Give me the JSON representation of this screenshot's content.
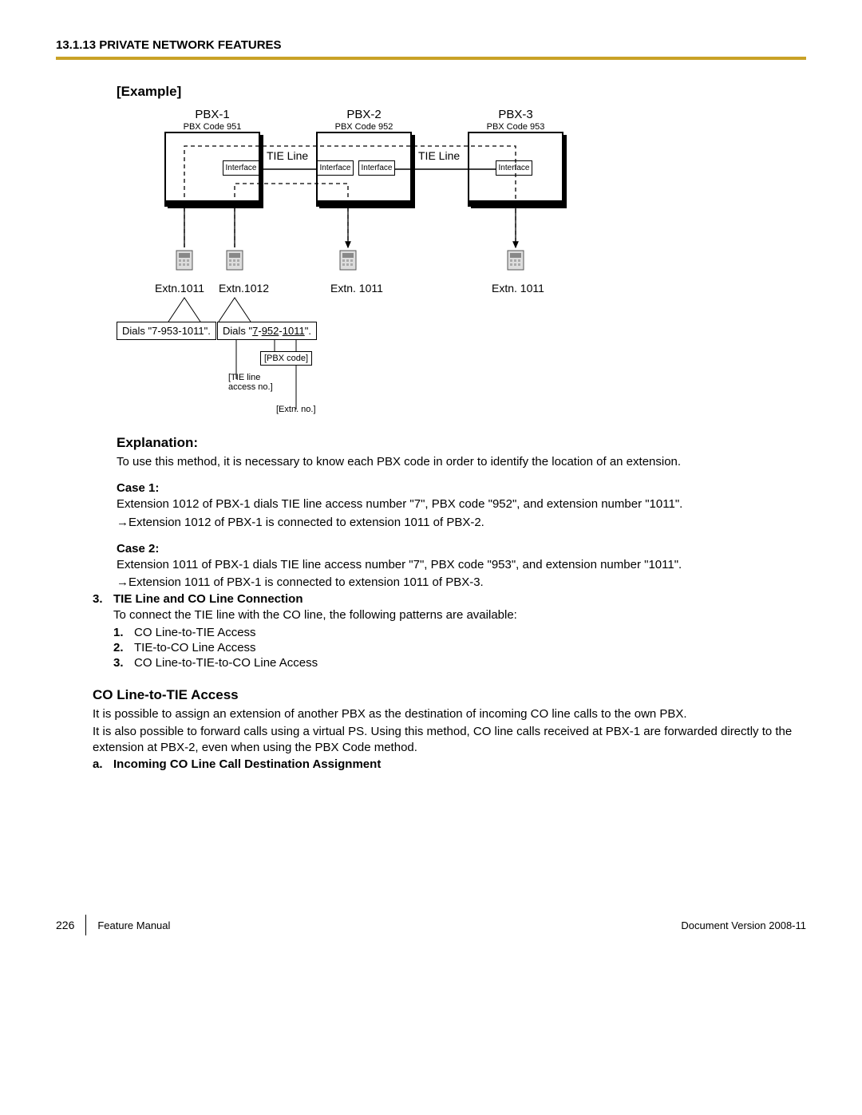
{
  "header": {
    "title": "13.1.13 PRIVATE NETWORK FEATURES"
  },
  "example": {
    "heading": "[Example]"
  },
  "diagram": {
    "pbx": [
      {
        "name": "PBX-1",
        "code": "PBX Code 951"
      },
      {
        "name": "PBX-2",
        "code": "PBX Code 952"
      },
      {
        "name": "PBX-3",
        "code": "PBX Code 953"
      }
    ],
    "interface": "Interface",
    "tie_line": "TIE Line",
    "ext": {
      "p1e1": "Extn.1011",
      "p1e2": "Extn.1012",
      "p2e1": "Extn. 1011",
      "p3e1": "Extn. 1011"
    },
    "dial1": "Dials \"7-953-1011\".",
    "dial2_pre": "Dials \"",
    "dial2_a": "7",
    "dial2_b": "952",
    "dial2_c": "1011",
    "dial2_post": "\".",
    "anno_pbx_code": "[PBX code]",
    "anno_tie_access": "[TIE line access no.]",
    "anno_ext_no": "[Extn. no.]"
  },
  "explanation": {
    "heading": "Explanation:",
    "text": "To use this method, it is necessary to know each PBX code in order to identify the location of an extension."
  },
  "case1": {
    "heading": "Case 1:",
    "line1": "Extension 1012 of PBX-1 dials TIE line access number \"7\", PBX code \"952\", and extension number \"1011\".",
    "line2": "Extension 1012 of PBX-1 is connected to extension 1011 of PBX-2."
  },
  "case2": {
    "heading": "Case 2:",
    "line1": "Extension 1011 of PBX-1 dials TIE line access number \"7\", PBX code \"953\", and extension number \"1011\".",
    "line2": "Extension 1011 of PBX-1 is connected to extension 1011 of PBX-3."
  },
  "section3": {
    "num": "3.",
    "title": "TIE Line and CO Line Connection",
    "intro": "To connect the TIE line with the CO line, the following patterns are available:",
    "items": [
      {
        "n": "1.",
        "t": "CO Line-to-TIE Access"
      },
      {
        "n": "2.",
        "t": "TIE-to-CO Line Access"
      },
      {
        "n": "3.",
        "t": "CO Line-to-TIE-to-CO Line Access"
      }
    ]
  },
  "co_tie": {
    "heading": "CO Line-to-TIE Access",
    "p1": "It is possible to assign an extension of another PBX as the destination of incoming CO line calls to the own PBX.",
    "p2": "It is also possible to forward calls using a virtual PS. Using this method, CO line calls received at PBX-1 are forwarded directly to the extension at PBX-2, even when using the PBX Code method.",
    "sub_a_num": "a.",
    "sub_a_title": "Incoming CO Line Call Destination Assignment"
  },
  "footer": {
    "page": "226",
    "manual": "Feature Manual",
    "version": "Document Version  2008-11"
  }
}
